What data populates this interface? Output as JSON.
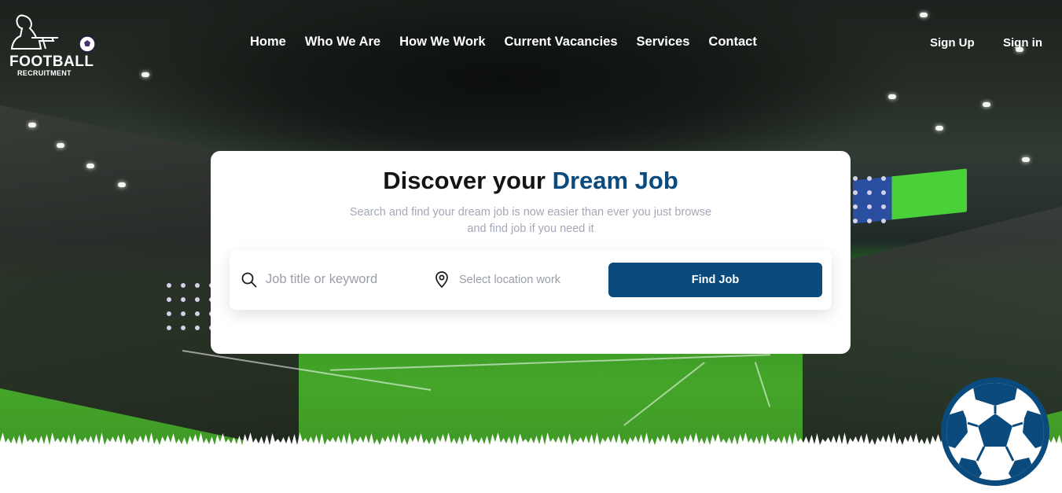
{
  "brand": {
    "title": "FOOTBALL",
    "subtitle": "RECRUITMENT"
  },
  "nav": {
    "items": [
      {
        "label": "Home"
      },
      {
        "label": "Who We Are"
      },
      {
        "label": "How We Work"
      },
      {
        "label": "Current Vacancies"
      },
      {
        "label": "Services"
      },
      {
        "label": "Contact"
      }
    ]
  },
  "auth": {
    "signup": "Sign Up",
    "signin": "Sign in"
  },
  "hero": {
    "title_plain": "Discover your ",
    "title_accent": "Dream Job",
    "subtitle": "Search and find your dream job is now easier than ever you just browse and find job if you need it"
  },
  "search": {
    "keyword_placeholder": "Job title or keyword",
    "keyword_value": "",
    "location_placeholder": "Select location work",
    "location_value": "",
    "button_label": "Find Job",
    "icons": [
      "search-icon",
      "map-pin-icon"
    ]
  },
  "colors": {
    "accent": "#0b4a7c",
    "subtitle": "#a4a8b8",
    "dots": "#d3d0ea"
  }
}
